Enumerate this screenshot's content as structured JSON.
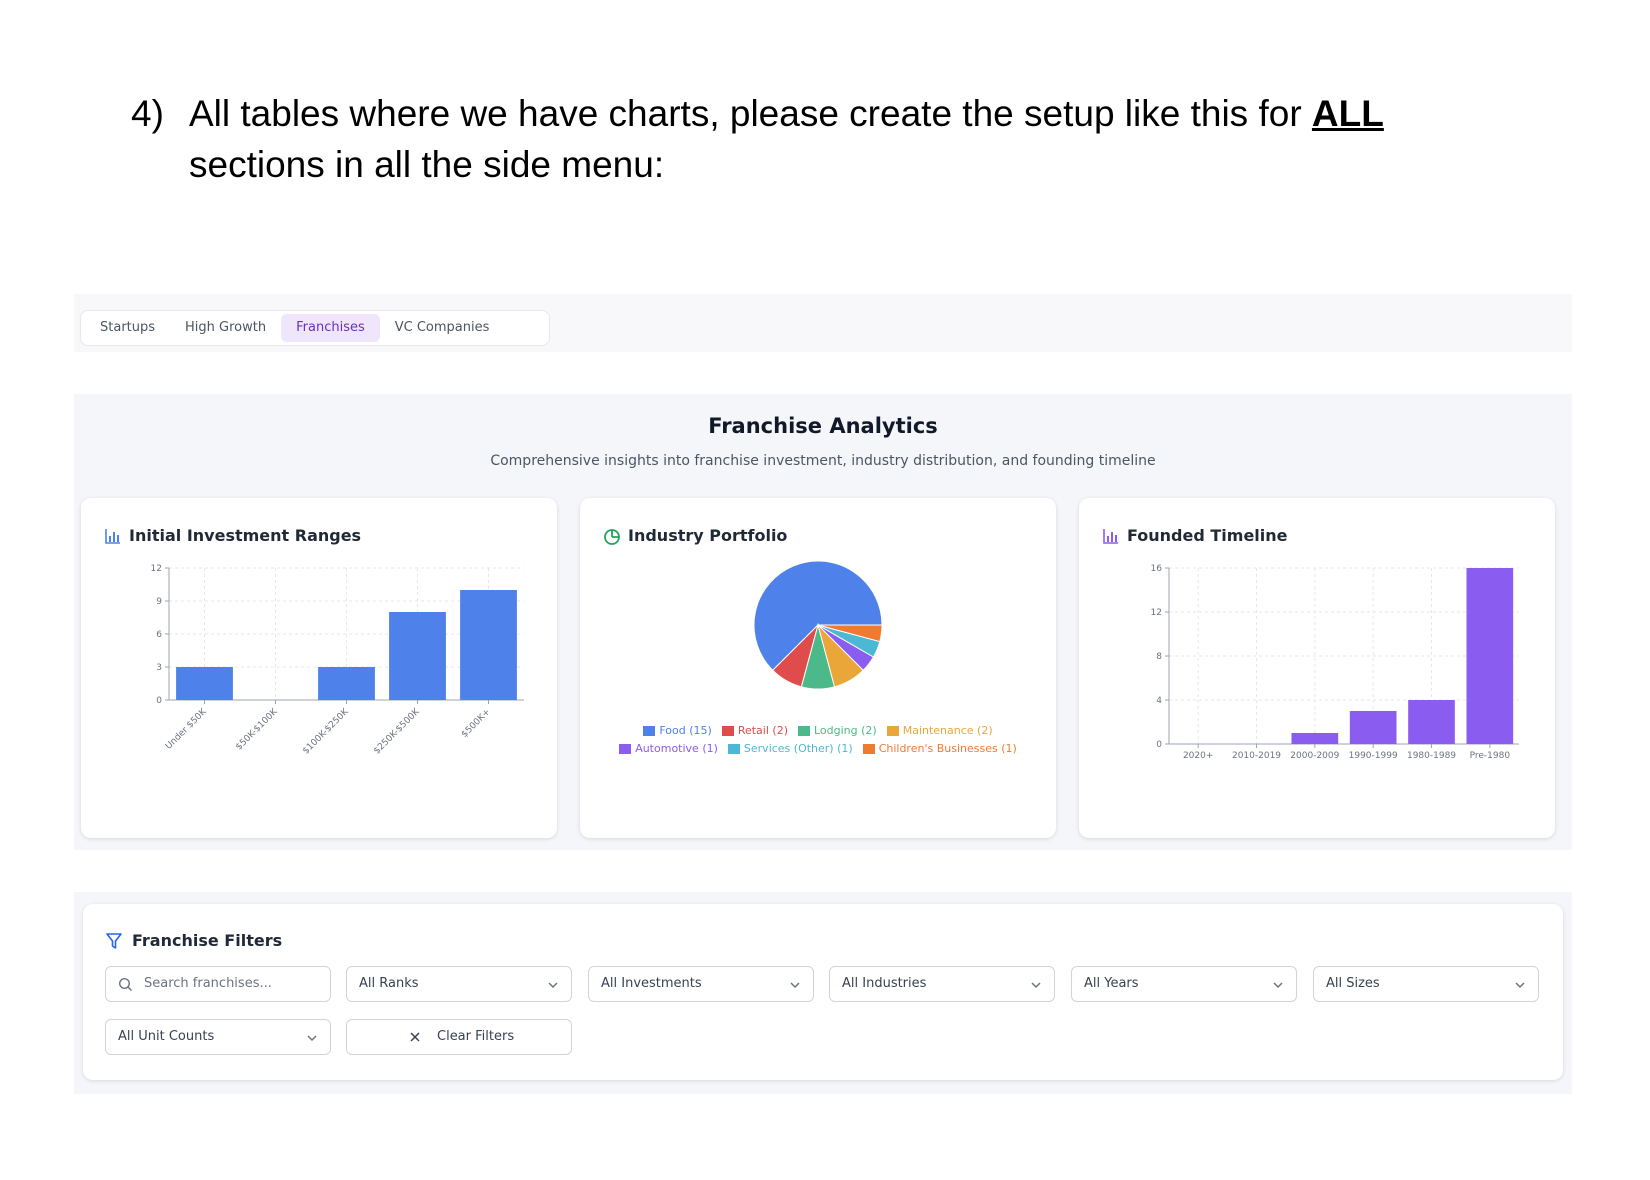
{
  "instruction": {
    "number": "4)",
    "text_before": "All tables where we have charts, please create the setup like this for ",
    "emphasis": "ALL",
    "text_after": " sections in all the side menu:"
  },
  "tabs": [
    {
      "label": "Startups",
      "active": false
    },
    {
      "label": "High Growth",
      "active": false
    },
    {
      "label": "Franchises",
      "active": true
    },
    {
      "label": "VC Companies",
      "active": false
    }
  ],
  "analytics": {
    "title": "Franchise Analytics",
    "subtitle": "Comprehensive insights into franchise investment, industry distribution, and founding timeline"
  },
  "cards": {
    "investment": {
      "title": "Initial Investment Ranges",
      "icon": "bar-chart-icon"
    },
    "industry": {
      "title": "Industry Portfolio",
      "icon": "pie-chart-icon"
    },
    "founded": {
      "title": "Founded Timeline",
      "icon": "bar-chart-icon"
    }
  },
  "colors": {
    "blue": "#4f81ea",
    "purple": "#8b5cf0",
    "accent_purple": "#6b2fbf",
    "filter_icon": "#2563eb"
  },
  "chart_data": [
    {
      "type": "bar",
      "title": "Initial Investment Ranges",
      "categories": [
        "Under $50K",
        "$50K-$100K",
        "$100K-$250K",
        "$250K-$500K",
        "$500K+"
      ],
      "values": [
        3,
        0,
        3,
        8,
        10
      ],
      "ylim": [
        0,
        12
      ],
      "yticks": [
        0,
        3,
        6,
        9,
        12
      ],
      "color": "#4f81ea",
      "grid": true
    },
    {
      "type": "pie",
      "title": "Industry Portfolio",
      "slices": [
        {
          "label": "Food (15)",
          "value": 15,
          "color": "#4f81ea"
        },
        {
          "label": "Retail (2)",
          "value": 2,
          "color": "#e04b4b"
        },
        {
          "label": "Lodging (2)",
          "value": 2,
          "color": "#4cb98a"
        },
        {
          "label": "Maintenance (2)",
          "value": 2,
          "color": "#eba63a"
        },
        {
          "label": "Automotive (1)",
          "value": 1,
          "color": "#8b5cf0"
        },
        {
          "label": "Services (Other) (1)",
          "value": 1,
          "color": "#4cb8d4"
        },
        {
          "label": "Children's Businesses (1)",
          "value": 1,
          "color": "#ef7b30"
        }
      ],
      "legend_placement": "bottom"
    },
    {
      "type": "bar",
      "title": "Founded Timeline",
      "categories": [
        "2020+",
        "2010-2019",
        "2000-2009",
        "1990-1999",
        "1980-1989",
        "Pre-1980"
      ],
      "values": [
        0,
        0,
        1,
        3,
        4,
        16
      ],
      "ylim": [
        0,
        16
      ],
      "yticks": [
        0,
        4,
        8,
        12,
        16
      ],
      "color": "#8b5cf0",
      "grid": true
    }
  ],
  "filters": {
    "title": "Franchise Filters",
    "search_placeholder": "Search franchises...",
    "selects": [
      "All Ranks",
      "All Investments",
      "All Industries",
      "All Years",
      "All Sizes",
      "All Unit Counts"
    ],
    "clear_label": "Clear Filters"
  }
}
